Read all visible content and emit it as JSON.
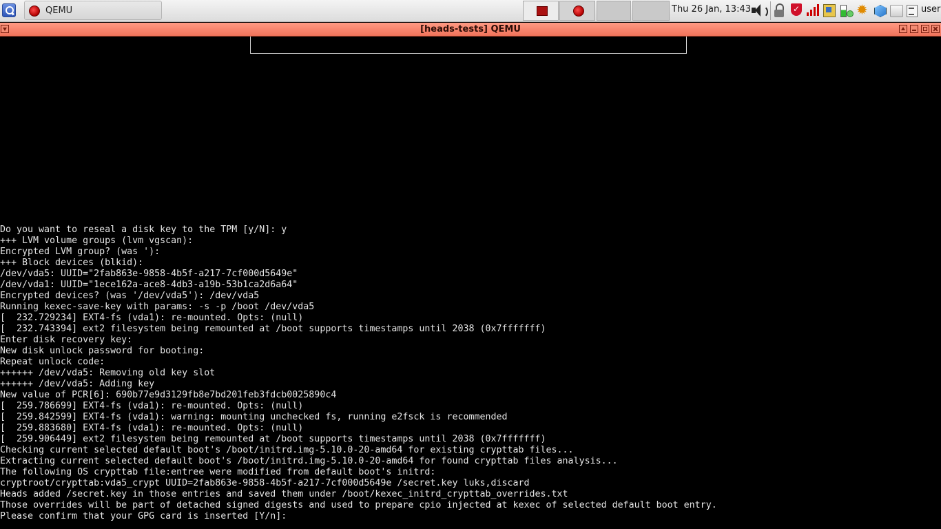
{
  "taskbar": {
    "task_label": "QEMU",
    "clock": "Thu 26 Jan, 13:43",
    "user": "user"
  },
  "window": {
    "title": "[heads-tests] QEMU",
    "titlebar_color": "#f47a62"
  },
  "console": {
    "lines": [
      "Do you want to reseal a disk key to the TPM [y/N]: y",
      "+++ LVM volume groups (lvm vgscan):",
      "Encrypted LVM group? (was '):",
      "+++ Block devices (blkid):",
      "/dev/vda5: UUID=\"2fab863e-9858-4b5f-a217-7cf000d5649e\"",
      "/dev/vda1: UUID=\"1ece162a-ace8-4db3-a19b-53b1ca2d6a64\"",
      "Encrypted devices? (was '/dev/vda5'): /dev/vda5",
      "Running kexec-save-key with params: -s -p /boot /dev/vda5",
      "[  232.729234] EXT4-fs (vda1): re-mounted. Opts: (null)",
      "[  232.743394] ext2 filesystem being remounted at /boot supports timestamps until 2038 (0x7fffffff)",
      "Enter disk recovery key:",
      "New disk unlock password for booting:",
      "Repeat unlock code:",
      "++++++ /dev/vda5: Removing old key slot",
      "++++++ /dev/vda5: Adding key",
      "New value of PCR[6]: 690b77e9d3129fb8e7bd201feb3fdcb0025890c4",
      "[  259.786699] EXT4-fs (vda1): re-mounted. Opts: (null)",
      "[  259.842599] EXT4-fs (vda1): warning: mounting unchecked fs, running e2fsck is recommended",
      "[  259.883680] EXT4-fs (vda1): re-mounted. Opts: (null)",
      "[  259.906449] ext2 filesystem being remounted at /boot supports timestamps until 2038 (0x7fffffff)",
      "Checking current selected default boot's /boot/initrd.img-5.10.0-20-amd64 for existing crypttab files...",
      "Extracting current selected default boot's /boot/initrd.img-5.10.0-20-amd64 for found crypttab files analysis...",
      "The following OS crypttab file:entree were modified from default boot's initrd:",
      "cryptroot/crypttab:vda5_crypt UUID=2fab863e-9858-4b5f-a217-7cf000d5649e /secret.key luks,discard",
      "Heads added /secret.key in those entries and saved them under /boot/kexec_initrd_crypttab_overrides.txt",
      "Those overrides will be part of detached signed digests and used to prepare cpio injected at kexec of selected default boot entry.",
      "Please confirm that your GPG card is inserted [Y/n]:"
    ]
  }
}
